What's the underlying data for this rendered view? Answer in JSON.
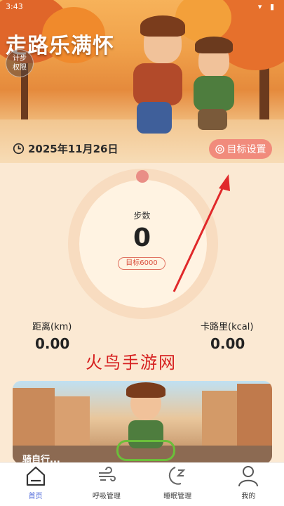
{
  "status": {
    "time": "3:43",
    "icons": "▾ ▮"
  },
  "hero": {
    "title": "走路乐满怀",
    "badge_line1": "计步",
    "badge_line2": "权限"
  },
  "date": {
    "text": "2025年11月26日"
  },
  "goal_button": {
    "label": "目标设置"
  },
  "steps": {
    "label": "步数",
    "value": "0",
    "target": "目标6000"
  },
  "stats": {
    "distance": {
      "label": "距离(km)",
      "value": "0.00"
    },
    "calories": {
      "label": "卡路里(kcal)",
      "value": "0.00"
    }
  },
  "watermark": "火鸟手游网",
  "card": {
    "caption": "骑自行..."
  },
  "nav": {
    "items": [
      {
        "label": "首页",
        "icon": "home-icon",
        "active": true
      },
      {
        "label": "呼吸管理",
        "icon": "wind-icon",
        "active": false
      },
      {
        "label": "睡眠管理",
        "icon": "moon-sleep-icon",
        "active": false
      },
      {
        "label": "我的",
        "icon": "user-icon",
        "active": false
      }
    ]
  },
  "colors": {
    "accent": "#f18b7c",
    "nav_active": "#4a64d8",
    "background": "#fbe9d3",
    "arrow": "#e0282a"
  }
}
